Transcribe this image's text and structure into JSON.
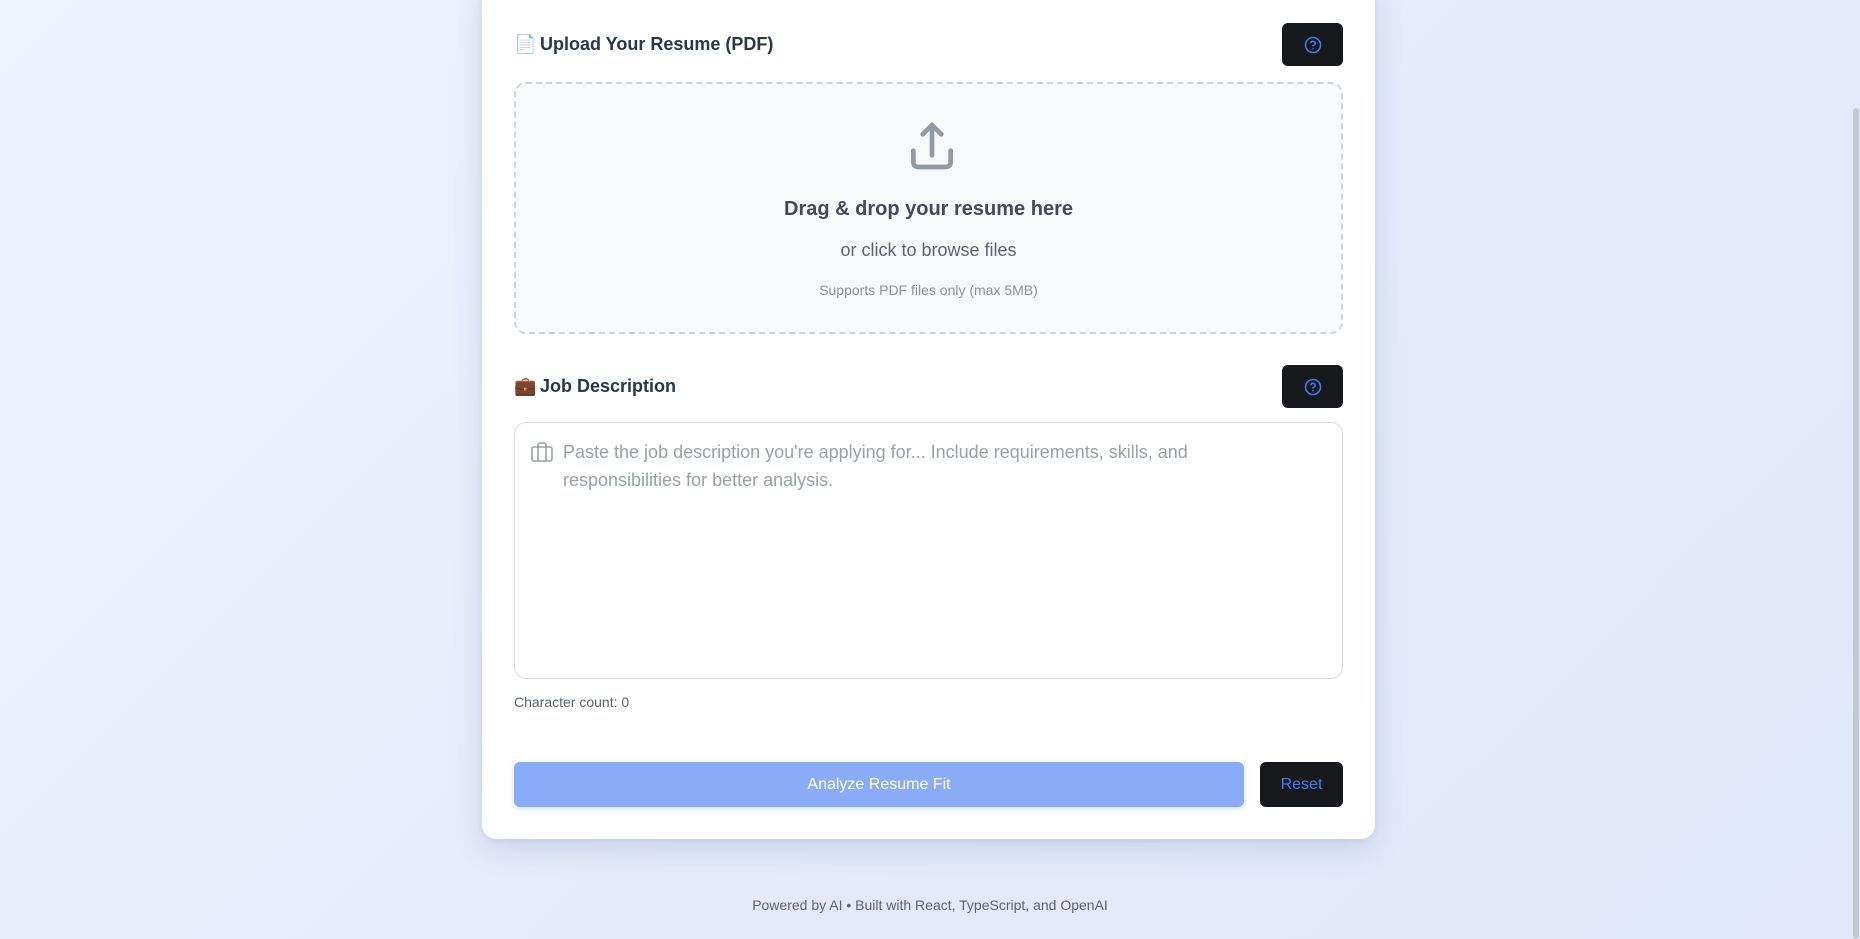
{
  "upload": {
    "emoji": "📄",
    "title": "Upload Your Resume (PDF)",
    "help_icon": "help-circle-icon",
    "dropzone": {
      "icon": "upload-icon",
      "title": "Drag & drop your resume here",
      "subtitle": "or click to browse files",
      "note": "Supports PDF files only (max 5MB)"
    }
  },
  "job": {
    "emoji": "💼",
    "title": "Job Description",
    "help_icon": "help-circle-icon",
    "field_icon": "briefcase-icon",
    "placeholder": "Paste the job description you're applying for... Include requirements, skills, and responsibilities for better analysis.",
    "value": "",
    "char_count_label": "Character count: 0"
  },
  "actions": {
    "analyze_label": "Analyze Resume Fit",
    "reset_label": "Reset"
  },
  "footer": {
    "text": "Powered by AI • Built with React, TypeScript, and OpenAI"
  },
  "colors": {
    "accent": "#3b82f6",
    "analyze_disabled": "#8aacf8",
    "dark_button": "#17181b"
  }
}
